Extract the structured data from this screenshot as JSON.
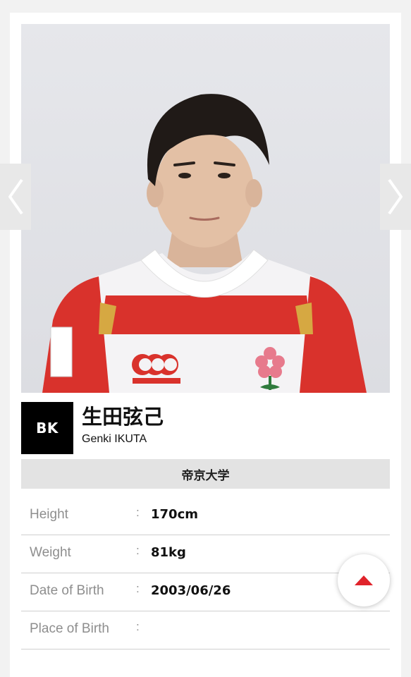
{
  "navigation": {
    "prev_icon": "chevron-left-icon",
    "next_icon": "chevron-right-icon"
  },
  "player": {
    "position": "BK",
    "name_ja": "生田弦己",
    "name_en": "Genki IKUTA",
    "school": "帝京大学",
    "photo_alt": "player-portrait"
  },
  "profile": {
    "separator": ":",
    "rows": [
      {
        "label": "Height",
        "value": "170cm"
      },
      {
        "label": "Weight",
        "value": "81kg"
      },
      {
        "label": "Date of Birth",
        "value": "2003/06/26"
      },
      {
        "label": "Place of Birth",
        "value": ""
      }
    ]
  },
  "scroll_top": {
    "icon": "triangle-up-icon"
  },
  "colors": {
    "accent": "#e0232b",
    "badge_bg": "#000000",
    "school_bar_bg": "#e3e3e3",
    "label_text": "#8e8e8e"
  }
}
